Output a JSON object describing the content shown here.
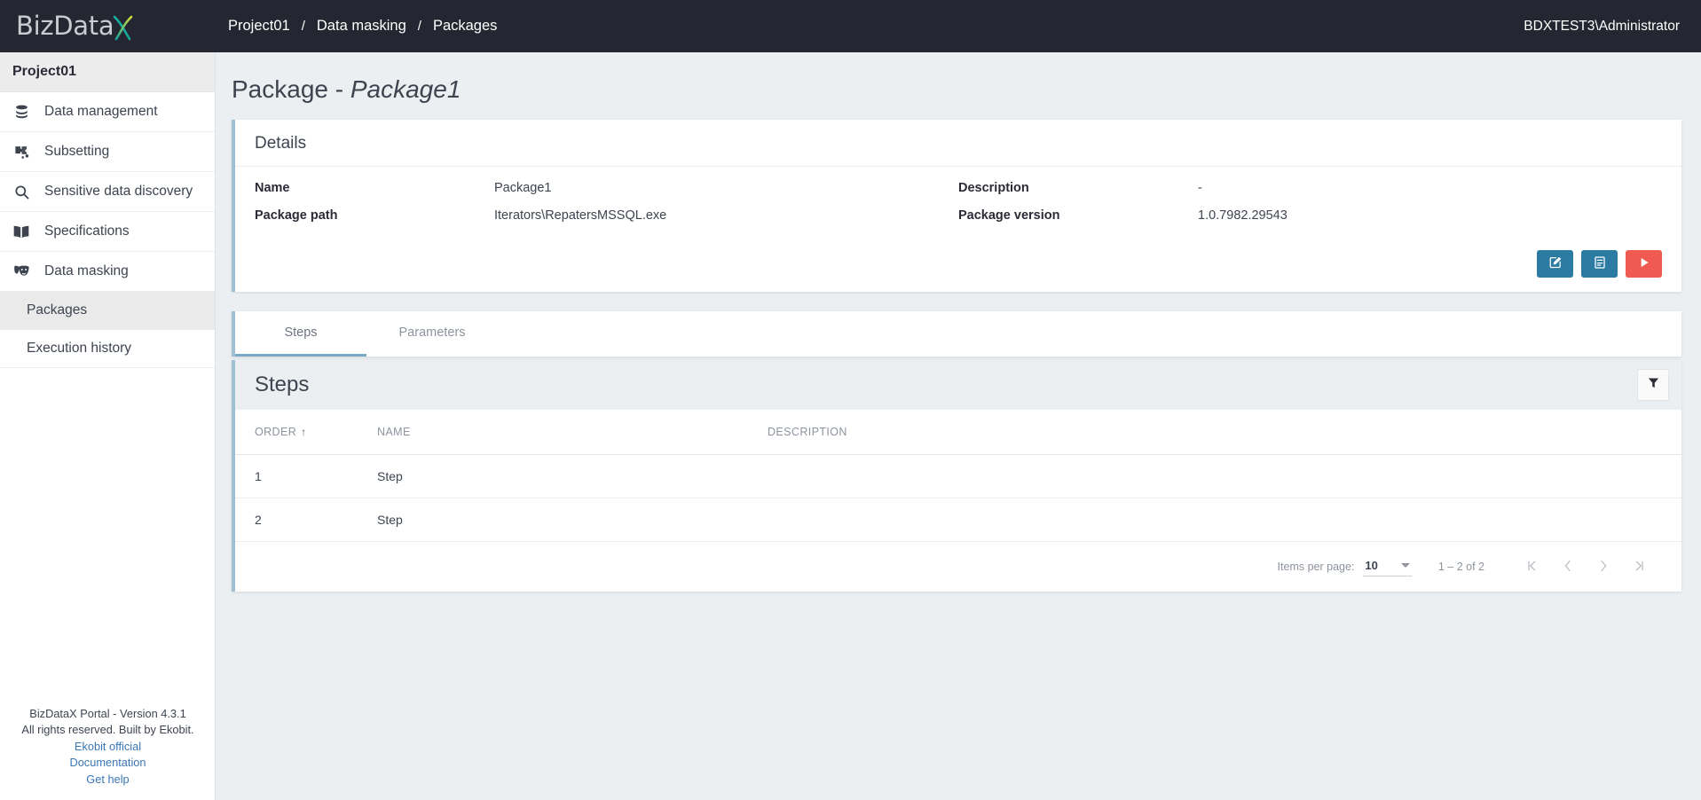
{
  "topbar": {
    "logo_text": "BizData",
    "logo_x": "X",
    "breadcrumb": [
      "Project01",
      "Data masking",
      "Packages"
    ],
    "separator": "/",
    "user": "BDXTEST3\\Administrator"
  },
  "sidebar": {
    "project": "Project01",
    "items": [
      {
        "label": "Data management",
        "icon": "database-icon"
      },
      {
        "label": "Subsetting",
        "icon": "puzzle-icon"
      },
      {
        "label": "Sensitive data discovery",
        "icon": "search-icon"
      },
      {
        "label": "Specifications",
        "icon": "book-icon"
      },
      {
        "label": "Data masking",
        "icon": "theater-masks-icon"
      }
    ],
    "subitems": [
      {
        "label": "Packages",
        "selected": true
      },
      {
        "label": "Execution history",
        "selected": false
      }
    ],
    "footer": {
      "version": "BizDataX Portal - Version 4.3.1",
      "rights": "All rights reserved. Built by Ekobit.",
      "links": [
        "Ekobit official",
        "Documentation",
        "Get help"
      ]
    }
  },
  "main": {
    "title_prefix": "Package - ",
    "title_name": "Package1",
    "details": {
      "header": "Details",
      "rows": [
        {
          "label": "Name",
          "value": "Package1",
          "label2": "Description",
          "value2": "-"
        },
        {
          "label": "Package path",
          "value": "Iterators\\RepatersMSSQL.exe",
          "label2": "Package version",
          "value2": "1.0.7982.29543"
        }
      ],
      "actions": [
        {
          "name": "edit-button",
          "icon": "edit-square-icon",
          "color": "#2b7ba3"
        },
        {
          "name": "report-button",
          "icon": "document-icon",
          "color": "#2b7ba3"
        },
        {
          "name": "run-button",
          "icon": "play-icon",
          "color": "#ef5b50"
        }
      ]
    },
    "tabs": [
      {
        "label": "Steps",
        "active": true
      },
      {
        "label": "Parameters",
        "active": false
      }
    ],
    "steps": {
      "title": "Steps",
      "filter_icon": "filter-funnel-icon",
      "columns": [
        "ORDER",
        "NAME",
        "DESCRIPTION"
      ],
      "sort_column": "ORDER",
      "sort_direction": "asc",
      "rows": [
        {
          "order": "1",
          "name": "Step",
          "description": ""
        },
        {
          "order": "2",
          "name": "Step",
          "description": ""
        }
      ],
      "paginator": {
        "items_per_page_label": "Items per page:",
        "items_per_page_value": "10",
        "range": "1 – 2 of 2",
        "first_icon": "first-page-icon",
        "prev_icon": "previous-page-icon",
        "next_icon": "next-page-icon",
        "last_icon": "last-page-icon"
      }
    }
  },
  "colors": {
    "topbar_bg": "#242731",
    "accent_border": "#9ebfd4",
    "primary_button": "#2b7ba3",
    "danger_button": "#ef5b50",
    "page_bg": "#eceff1",
    "link": "#3a76b5"
  }
}
